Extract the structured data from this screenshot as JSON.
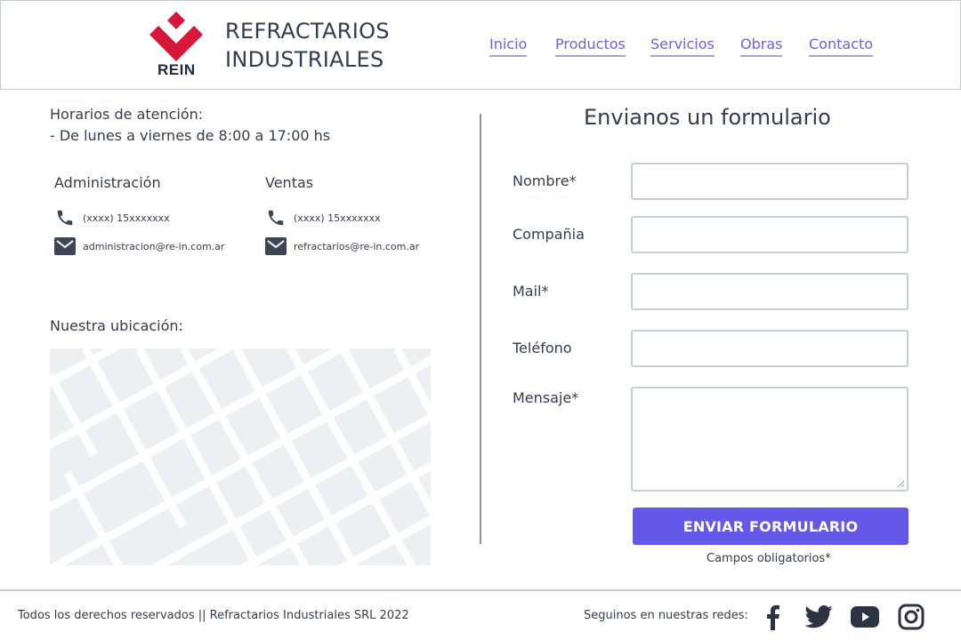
{
  "header": {
    "logo_text": "REIN",
    "brand_line1": "REFRACTARIOS",
    "brand_line2": "INDUSTRIALES",
    "nav": [
      {
        "label": "Inicio"
      },
      {
        "label": "Productos"
      },
      {
        "label": "Servicios"
      },
      {
        "label": "Obras"
      },
      {
        "label": "Contacto"
      }
    ]
  },
  "info": {
    "hours_title": "Horarios de atención:",
    "hours_detail": "- De lunes a viernes de 8:00 a 17:00 hs",
    "administration": {
      "title": "Administración",
      "phone": "(xxxx) 15xxxxxxx",
      "email": "administracion@re-in.com.ar"
    },
    "sales": {
      "title": "Ventas",
      "phone": "(xxxx) 15xxxxxxx",
      "email": "refractarios@re-in.com.ar"
    },
    "location_title": "Nuestra ubicación:"
  },
  "form": {
    "title": "Envianos un formulario",
    "fields": {
      "name_label": "Nombre*",
      "company_label": "Compañia",
      "mail_label": "Mail*",
      "phone_label": "Teléfono",
      "message_label": "Mensaje*"
    },
    "submit_label": "ENVIAR FORMULARIO",
    "required_note": "Campos obligatorios*"
  },
  "footer": {
    "copyright": "Todos los derechos reservados || Refractarios Industriales SRL 2022",
    "social_label": "Seguinos en nuestras redes:",
    "social_icons": [
      "facebook-icon",
      "twitter-icon",
      "youtube-icon",
      "instagram-icon"
    ]
  },
  "colors": {
    "accent": "#6557e8",
    "nav_link": "#7060e8",
    "logo_red": "#d7173a",
    "text": "#333d4f",
    "border": "#c4ccd6",
    "map_bg": "#edeff3"
  }
}
